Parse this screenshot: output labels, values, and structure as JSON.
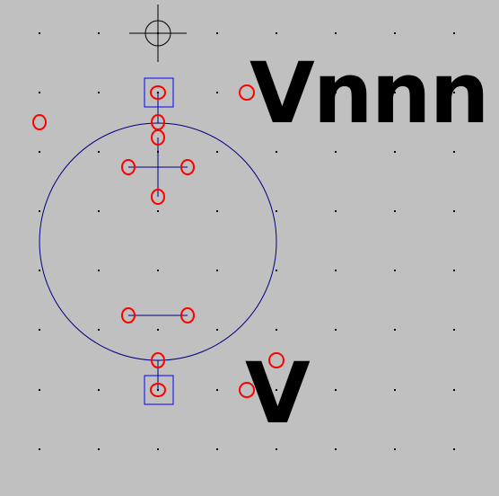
{
  "symbol": {
    "instance_name": "Vnnn",
    "value": "V"
  },
  "colors": {
    "background": "#c0c0c0",
    "grid_dot": "#000000",
    "body": "#000080",
    "pin_box": "#0000ff",
    "anchor_circle": "#ff0000",
    "text": "#000000"
  },
  "icons": {
    "origin": "crosshair-origin-icon"
  }
}
